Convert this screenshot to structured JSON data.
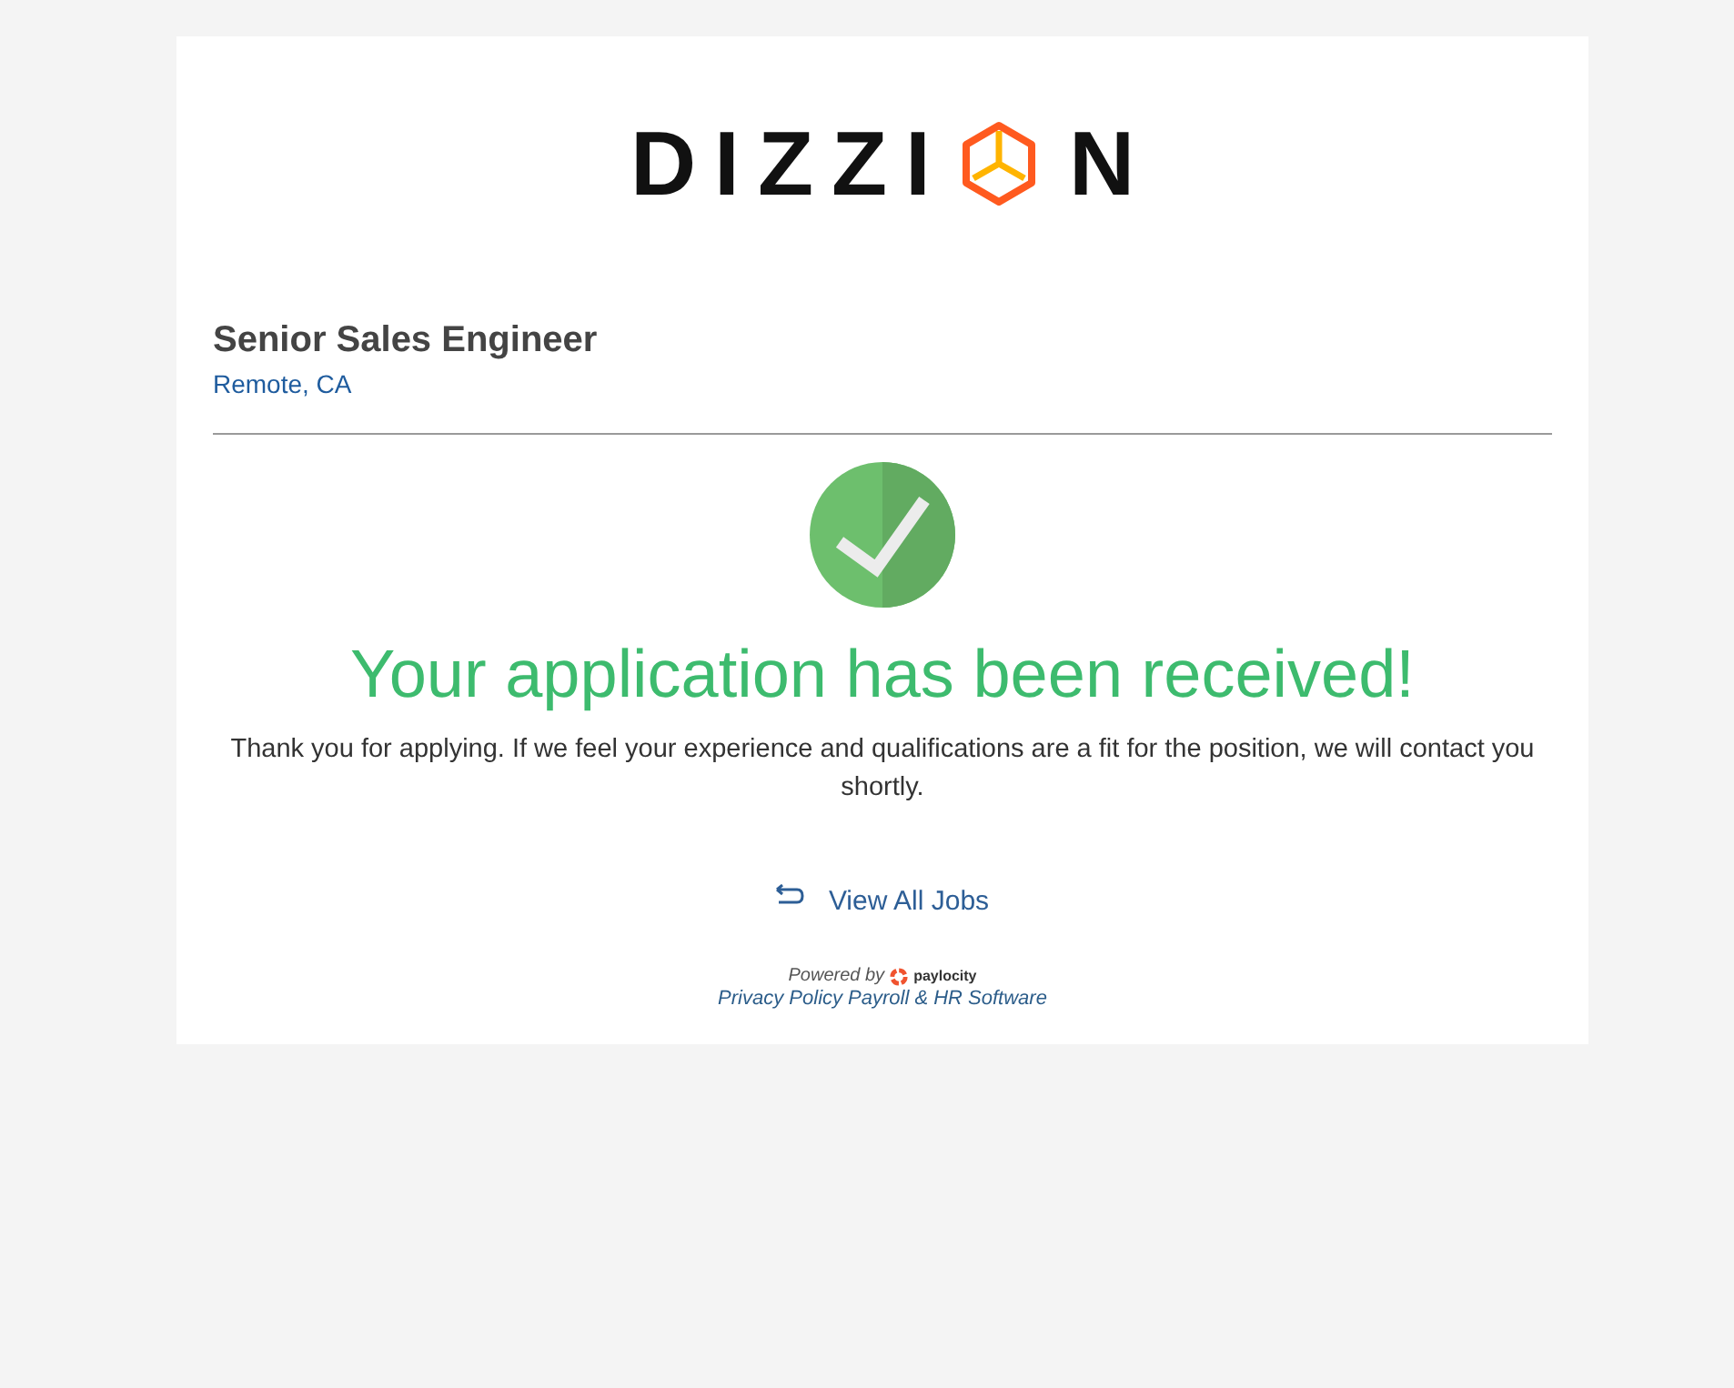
{
  "logo": {
    "leading": "DIZZI",
    "trailing": "N"
  },
  "job": {
    "title": "Senior Sales Engineer",
    "location": "Remote, CA"
  },
  "confirmation": {
    "heading": "Your application has been received!",
    "message": "Thank you for applying. If we feel your experience and qualifications are a fit for the position, we will contact you shortly."
  },
  "back_link": {
    "label": "View All Jobs"
  },
  "footer": {
    "powered_by": "Powered by",
    "brand": "paylocity",
    "links": [
      "Privacy Policy",
      "Payroll & HR Software"
    ]
  }
}
